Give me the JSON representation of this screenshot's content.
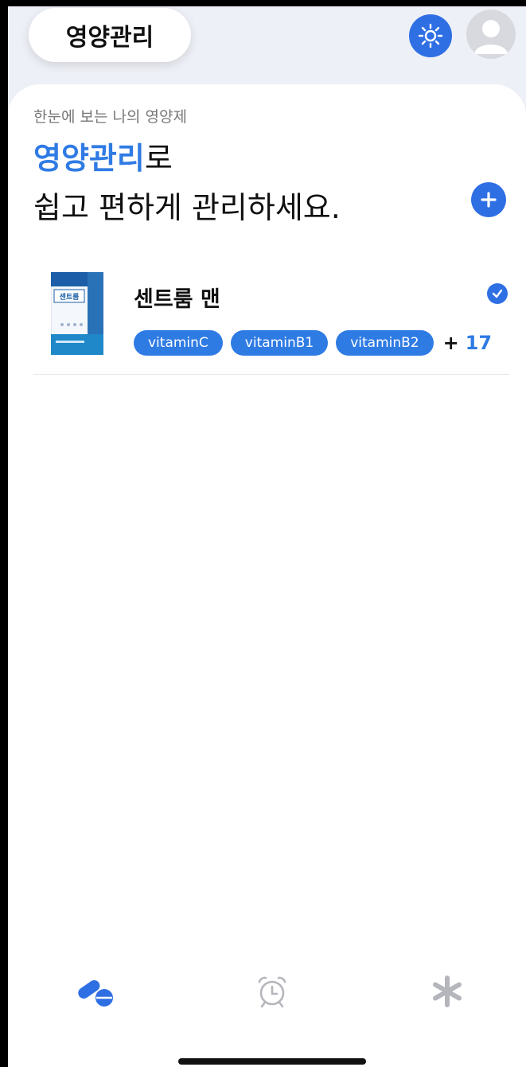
{
  "header": {
    "title": "영양관리"
  },
  "intro": {
    "subtitle": "한눈에 보는 나의 영양제",
    "headline_accent": "영양관리",
    "headline_rest": "로",
    "headline_line2": "쉽고 편하게 관리하세요."
  },
  "supplements": [
    {
      "name": "센트룸 맨",
      "image_label": "센트룸",
      "tags": [
        "vitaminC",
        "vitaminB1",
        "vitaminB2"
      ],
      "more_plus": "+",
      "more_count": "17",
      "checked": true
    }
  ],
  "tabs": [
    {
      "icon": "pill-icon",
      "active": true
    },
    {
      "icon": "alarm-clock-icon",
      "active": false
    },
    {
      "icon": "asterisk-icon",
      "active": false
    }
  ],
  "colors": {
    "accent": "#2f7be4",
    "background": "#eef0f7",
    "inactive_icon": "#b4b6bb"
  }
}
